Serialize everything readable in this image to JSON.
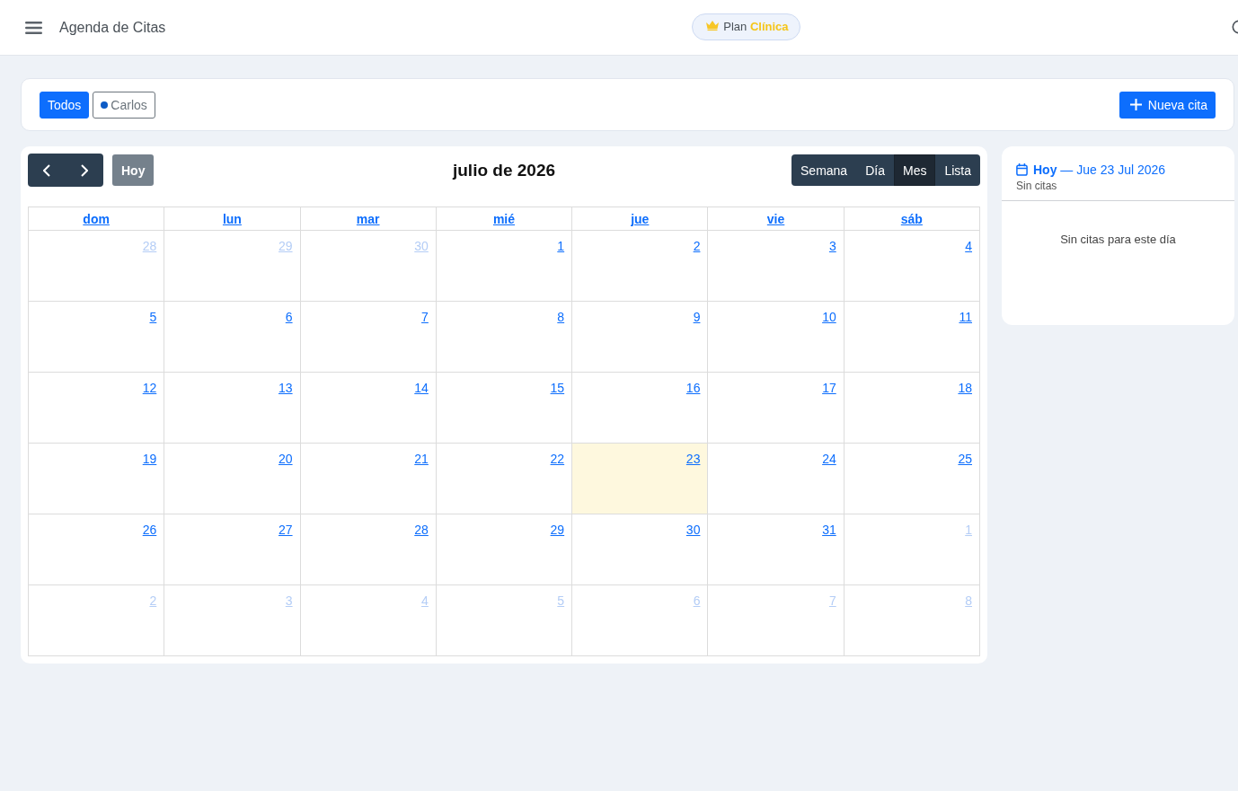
{
  "header": {
    "title": "Agenda de Citas",
    "plan_badge": "Plan **Clínica**"
  },
  "filters": {
    "people": [
      {
        "label": "Todos",
        "selected": true
      },
      {
        "label": "Carlos",
        "selected": false,
        "color": "#0d5bc6"
      }
    ],
    "new_button": "Nueva cita"
  },
  "calendar": {
    "today_button": {
      "label": "Hoy",
      "disabled": true
    },
    "title": "julio de 2026",
    "views": [
      {
        "label": "Semana",
        "selected": false
      },
      {
        "label": "Día",
        "selected": false
      },
      {
        "label": "Mes",
        "selected": true
      },
      {
        "label": "Lista",
        "selected": false
      }
    ],
    "weekdays": [
      "dom",
      "lun",
      "mar",
      "mié",
      "jue",
      "vie",
      "sáb"
    ],
    "weeks": [
      [
        {
          "day": "28",
          "other_month": true,
          "today": false
        },
        {
          "day": "29",
          "other_month": true,
          "today": false
        },
        {
          "day": "30",
          "other_month": true,
          "today": false
        },
        {
          "day": "1",
          "other_month": false,
          "today": false
        },
        {
          "day": "2",
          "other_month": false,
          "today": false
        },
        {
          "day": "3",
          "other_month": false,
          "today": false
        },
        {
          "day": "4",
          "other_month": false,
          "today": false
        }
      ],
      [
        {
          "day": "5",
          "other_month": false,
          "today": false
        },
        {
          "day": "6",
          "other_month": false,
          "today": false
        },
        {
          "day": "7",
          "other_month": false,
          "today": false
        },
        {
          "day": "8",
          "other_month": false,
          "today": false
        },
        {
          "day": "9",
          "other_month": false,
          "today": false
        },
        {
          "day": "10",
          "other_month": false,
          "today": false
        },
        {
          "day": "11",
          "other_month": false,
          "today": false
        }
      ],
      [
        {
          "day": "12",
          "other_month": false,
          "today": false
        },
        {
          "day": "13",
          "other_month": false,
          "today": false
        },
        {
          "day": "14",
          "other_month": false,
          "today": false
        },
        {
          "day": "15",
          "other_month": false,
          "today": false
        },
        {
          "day": "16",
          "other_month": false,
          "today": false
        },
        {
          "day": "17",
          "other_month": false,
          "today": false
        },
        {
          "day": "18",
          "other_month": false,
          "today": false
        }
      ],
      [
        {
          "day": "19",
          "other_month": false,
          "today": false
        },
        {
          "day": "20",
          "other_month": false,
          "today": false
        },
        {
          "day": "21",
          "other_month": false,
          "today": false
        },
        {
          "day": "22",
          "other_month": false,
          "today": false
        },
        {
          "day": "23",
          "other_month": false,
          "today": true
        },
        {
          "day": "24",
          "other_month": false,
          "today": false
        },
        {
          "day": "25",
          "other_month": false,
          "today": false
        }
      ],
      [
        {
          "day": "26",
          "other_month": false,
          "today": false
        },
        {
          "day": "27",
          "other_month": false,
          "today": false
        },
        {
          "day": "28",
          "other_month": false,
          "today": false
        },
        {
          "day": "29",
          "other_month": false,
          "today": false
        },
        {
          "day": "30",
          "other_month": false,
          "today": false
        },
        {
          "day": "31",
          "other_month": false,
          "today": false
        },
        {
          "day": "1",
          "other_month": true,
          "today": false
        }
      ],
      [
        {
          "day": "2",
          "other_month": true,
          "today": false
        },
        {
          "day": "3",
          "other_month": true,
          "today": false
        },
        {
          "day": "4",
          "other_month": true,
          "today": false
        },
        {
          "day": "5",
          "other_month": true,
          "today": false
        },
        {
          "day": "6",
          "other_month": true,
          "today": false
        },
        {
          "day": "7",
          "other_month": true,
          "today": false
        },
        {
          "day": "8",
          "other_month": true,
          "today": false
        }
      ]
    ]
  },
  "side_panel": {
    "heading": "**Hoy** — Jue 23 Jul 2026",
    "subtitle": "Sin citas",
    "empty_message": "Sin citas para este día"
  }
}
